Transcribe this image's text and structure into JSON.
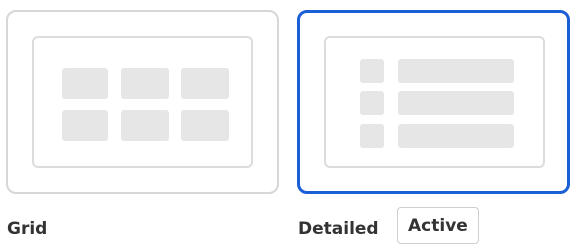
{
  "layout_options": {
    "grid": {
      "label": "Grid"
    },
    "detailed": {
      "label": "Detailed",
      "badge": "Active"
    }
  }
}
